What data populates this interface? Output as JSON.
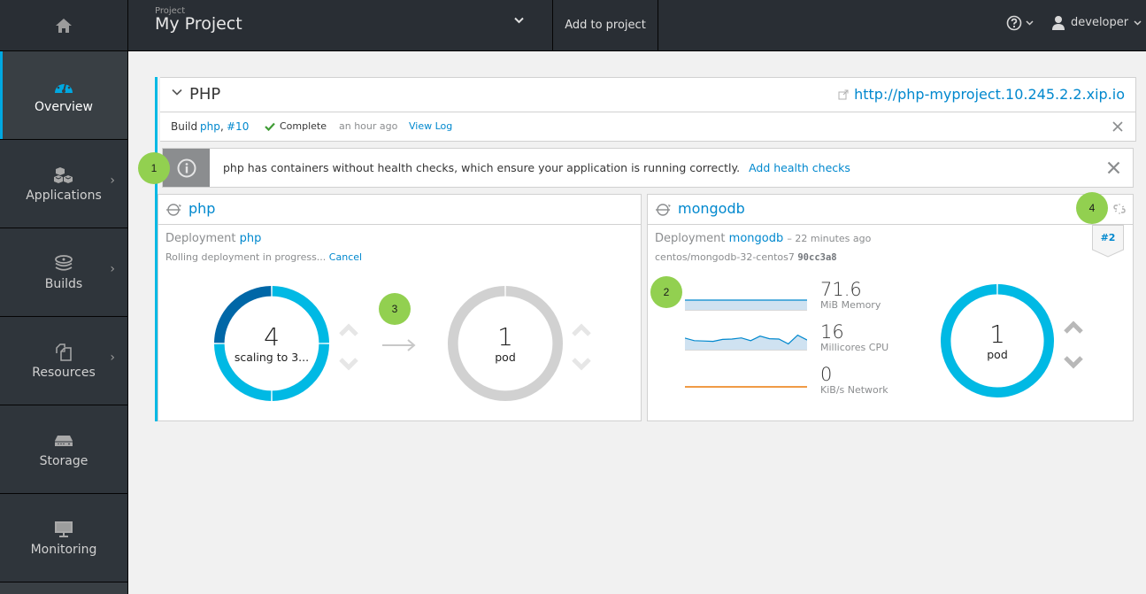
{
  "topbar": {
    "home_icon": "home-icon",
    "project_label": "Project",
    "project_name": "My Project",
    "project_dropdown_icon": "chevron-down-icon",
    "add_to_project_label": "Add to project",
    "help_icon": "question-circle-icon",
    "user_icon": "user-icon",
    "username": "developer"
  },
  "sidebar": {
    "items": [
      {
        "label": "Overview",
        "icon": "dashboard-gauge-icon",
        "active": true,
        "has_submenu": false
      },
      {
        "label": "Applications",
        "icon": "cubes-icon",
        "active": false,
        "has_submenu": true
      },
      {
        "label": "Builds",
        "icon": "layers-icon",
        "active": false,
        "has_submenu": true
      },
      {
        "label": "Resources",
        "icon": "copy-files-icon",
        "active": false,
        "has_submenu": true
      },
      {
        "label": "Storage",
        "icon": "hard-drive-icon",
        "active": false,
        "has_submenu": false
      },
      {
        "label": "Monitoring",
        "icon": "monitor-icon",
        "active": false,
        "has_submenu": false
      }
    ]
  },
  "service_group": {
    "title": "PHP",
    "route_url": "http://php-myproject.10.245.2.2.xip.io",
    "build": {
      "prefix": "Build",
      "name": "php",
      "number": "#10",
      "status": "Complete",
      "time": "an hour ago",
      "view_log_label": "View Log"
    },
    "alert": {
      "message": "php has containers without health checks, which ensure your application is running correctly.",
      "action_label": "Add health checks"
    }
  },
  "deployments": {
    "php": {
      "name": "php",
      "deployment_prefix": "Deployment",
      "deployment_name": "php",
      "status_text": "Rolling deployment in progress...",
      "cancel_label": "Cancel",
      "old_pods": {
        "count": "4",
        "label": "scaling to 3...",
        "segments_total": 4,
        "terminating": 1,
        "color_running": "#00b9e4",
        "color_terminating": "#0067a7"
      },
      "new_pods": {
        "count": "1",
        "label": "pod",
        "color": "#d1d1d1"
      }
    },
    "mongodb": {
      "name": "mongodb",
      "deployment_prefix": "Deployment",
      "deployment_name": "mongodb",
      "age": "– 22 minutes ago",
      "image": "centos/mongodb-32-centos7",
      "image_id": "90cc3a8",
      "deployment_number": "#2",
      "pods": {
        "count": "1",
        "label": "pod",
        "color": "#00b9e4"
      },
      "metrics": [
        {
          "value": "71.6",
          "label": "MiB Memory",
          "color": "#0088ce",
          "series": [
            0.5,
            0.5,
            0.5,
            0.5,
            0.5,
            0.5,
            0.5,
            0.5,
            0.5,
            0.5,
            0.5,
            0.5,
            0.5,
            0.5,
            0.5
          ]
        },
        {
          "value": "16",
          "label": "Millicores CPU",
          "color": "#0088ce",
          "series": [
            0.55,
            0.42,
            0.4,
            0.38,
            0.48,
            0.5,
            0.56,
            0.42,
            0.65,
            0.52,
            0.5,
            0.25,
            0.7,
            0.45
          ]
        },
        {
          "value": "0",
          "label": "KiB/s Network",
          "color": "#ec7a08",
          "series": [
            0,
            0,
            0,
            0,
            0,
            0,
            0,
            0,
            0,
            0,
            0,
            0,
            0,
            0
          ]
        }
      ]
    }
  },
  "callouts": [
    "1",
    "2",
    "3",
    "4"
  ],
  "colors": {
    "accent": "#00b9e4",
    "link": "#0088ce",
    "navbar": "#292e34",
    "sidebar": "#2f353b",
    "callout": "#92d050"
  }
}
